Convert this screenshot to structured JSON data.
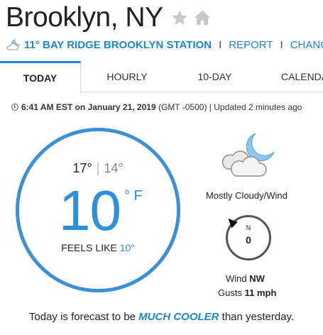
{
  "location": {
    "city": "Brooklyn, NY"
  },
  "station": {
    "name": "11° BAY RIDGE BROOKLYN STATION",
    "report_label": "REPORT",
    "change_label": "CHANG"
  },
  "tabs": [
    {
      "label": "TODAY",
      "active": true
    },
    {
      "label": "HOURLY"
    },
    {
      "label": "10-DAY"
    },
    {
      "label": "CALENDA"
    }
  ],
  "updated": {
    "time": "6:41 AM EST on January 21, 2019",
    "tz": "(GMT -0500)",
    "ago": "Updated 2 minutes ago"
  },
  "current": {
    "high": "17°",
    "low": "14°",
    "divider": "|",
    "temp": "10",
    "unit": "° F",
    "feels_like_label": "FEELS LIKE",
    "feels_like_value": "10°",
    "condition": "Mostly Cloudy/Wind",
    "condition_icon": "mostly-cloudy-night-icon"
  },
  "wind": {
    "dial_dir": "N",
    "speed": "0",
    "label_prefix": "Wind",
    "direction": "NW",
    "gusts_prefix": "Gusts",
    "gusts_value": "11 mph"
  },
  "forecast": {
    "prefix": "Today is forecast to be",
    "emphasis": "MUCH COOLER",
    "suffix": "than yesterday."
  },
  "colors": {
    "accent": "#1e88c9",
    "temp_blue": "#2f8fd8",
    "circle": "#3d8fd6"
  }
}
